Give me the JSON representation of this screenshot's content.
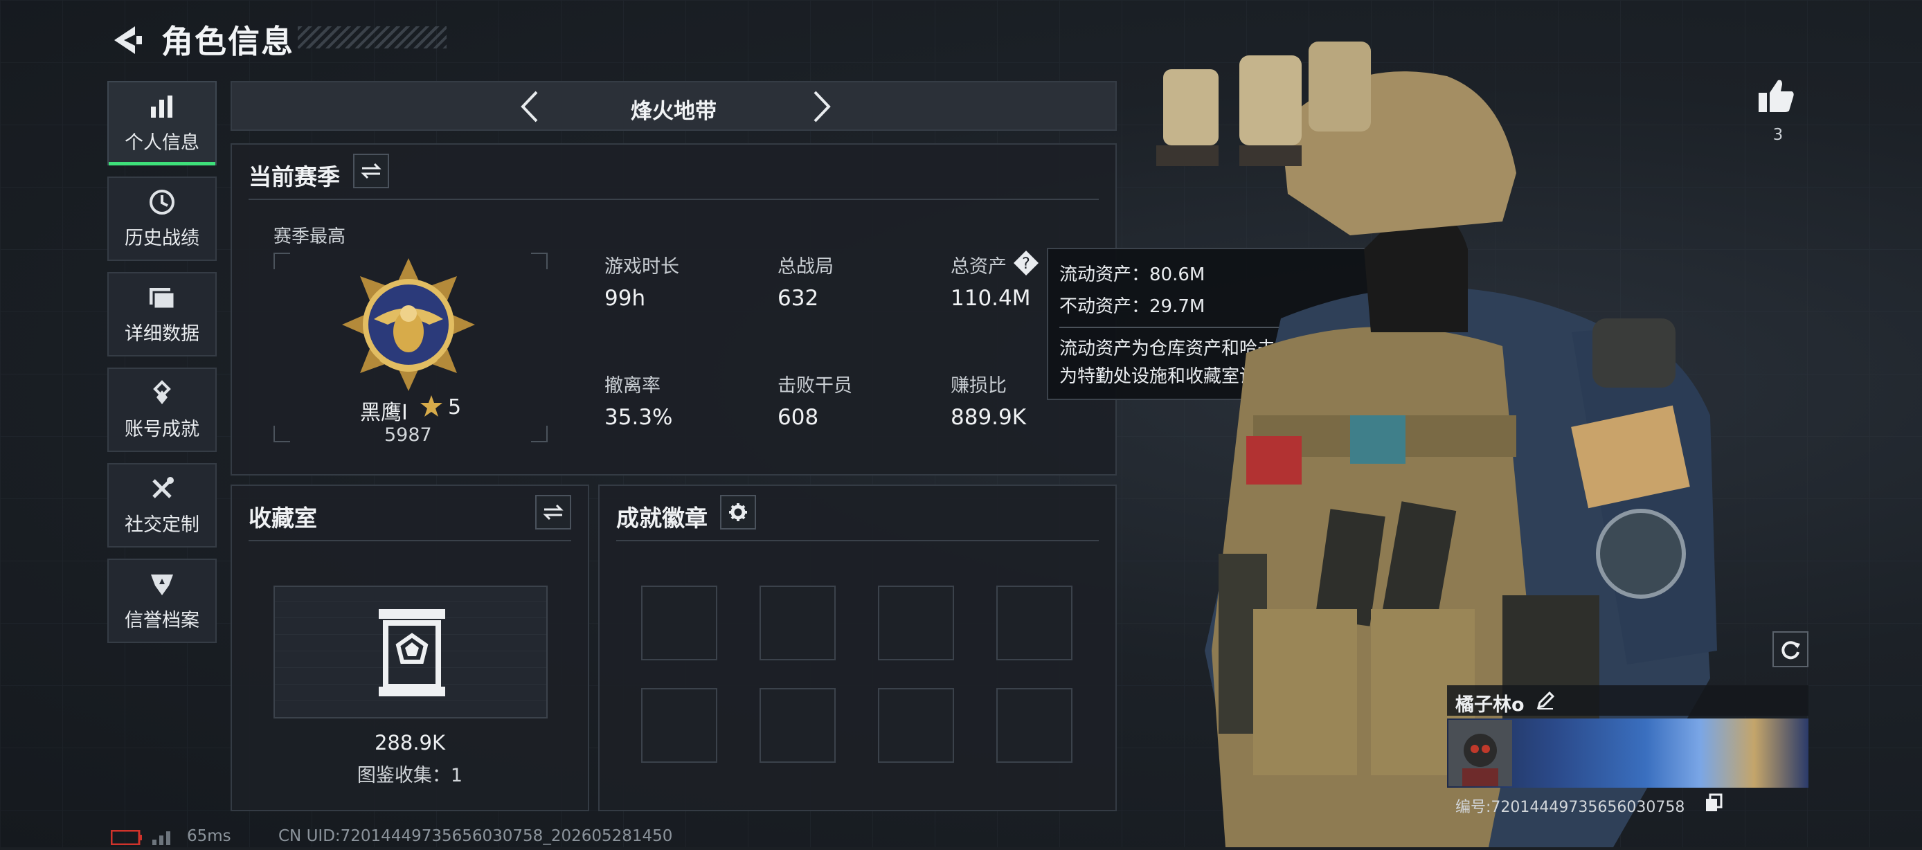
{
  "header": {
    "title": "角色信息"
  },
  "sidebar": {
    "items": [
      {
        "label": "个人信息",
        "icon": "bar-chart-icon",
        "active": true
      },
      {
        "label": "历史战绩",
        "icon": "clock-icon",
        "active": false
      },
      {
        "label": "详细数据",
        "icon": "folder-icon",
        "active": false
      },
      {
        "label": "账号成就",
        "icon": "achievement-icon",
        "active": false
      },
      {
        "label": "社交定制",
        "icon": "tools-icon",
        "active": false
      },
      {
        "label": "信誉档案",
        "icon": "credit-icon",
        "active": false
      }
    ]
  },
  "mode": {
    "name": "烽火地带"
  },
  "season": {
    "title": "当前赛季",
    "best_label": "赛季最高",
    "rank_name": "黑鹰I",
    "rank_stars": "5",
    "rank_score": "5987",
    "stats": [
      {
        "label": "游戏时长",
        "value": "99h"
      },
      {
        "label": "总战局",
        "value": "632"
      },
      {
        "label": "总资产",
        "value": "110.4M"
      },
      {
        "label": "撤离率",
        "value": "35.3%"
      },
      {
        "label": "击败干员",
        "value": "608"
      },
      {
        "label": "赚损比",
        "value": "889.9K"
      }
    ],
    "help_glyph": "?"
  },
  "tooltip": {
    "liquid": "流动资产：80.6M",
    "fixed": "不动资产：29.7M",
    "desc_line1": "流动资产为仓库资产和哈夫币，不动资产",
    "desc_line2": "为特勤处设施和收藏室设施"
  },
  "collection": {
    "title": "收藏室",
    "value": "288.9K",
    "count_text": "图鉴收集：1"
  },
  "badges": {
    "title": "成就徽章",
    "slots": 8
  },
  "profile": {
    "likes": "3",
    "nickname": "橘子林o",
    "uid_label": "编号:720144497356560307​58",
    "uid_text": "编号:72014449735656030758"
  },
  "statusbar": {
    "ping": "65ms",
    "uid_line": "CN UID:72014449735656030758_202605281450"
  },
  "colors": {
    "accent_green": "#3ee07a",
    "gold": "#d7ab4a",
    "background": "#1b1f24"
  }
}
